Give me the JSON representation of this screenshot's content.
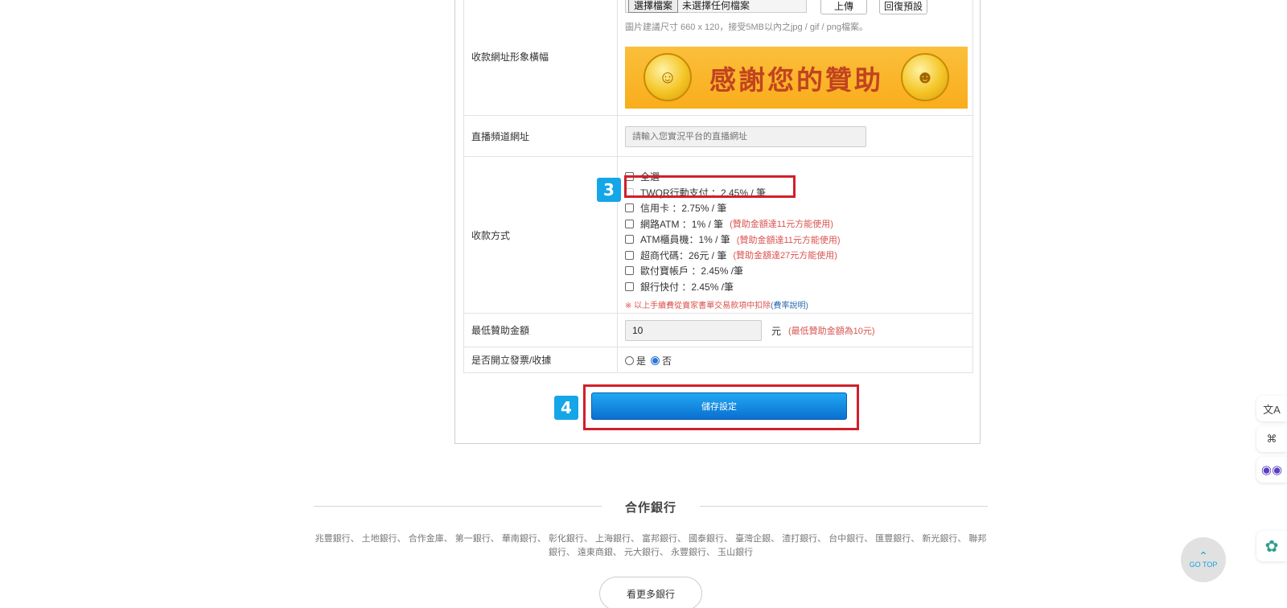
{
  "form": {
    "banner_row": {
      "label": "收款網址形象橫幅",
      "choose_file": "選擇檔案",
      "no_file": "未選擇任何檔案",
      "upload": "上傳",
      "reset": "回復預設",
      "hint": "圖片建議尺寸 660 x 120，接受5MB以內之jpg / gif / png檔案。",
      "banner_text": "感謝您的贊助"
    },
    "live_row": {
      "label": "直播頻道網址",
      "placeholder": "請輸入您實況平台的直播網址"
    },
    "payment_row": {
      "label": "收款方式",
      "select_all": "全選",
      "methods": [
        {
          "label": "TWQR行動支付 ：2.45% / 筆",
          "note": ""
        },
        {
          "label": "信用卡 ：2.75% / 筆",
          "note": ""
        },
        {
          "label": "網路ATM ：1% / 筆",
          "note": "(贊助金額達11元方能使用)"
        },
        {
          "label": "ATM櫃員機：1% / 筆",
          "note": "(贊助金額達11元方能使用)"
        },
        {
          "label": "超商代碼：26元 / 筆",
          "note": "(贊助金額達27元方能使用)"
        },
        {
          "label": "歐付寶帳戶 ：2.45% /筆",
          "note": ""
        },
        {
          "label": "銀行快付 ：2.45% /筆",
          "note": ""
        }
      ],
      "fee_note": "※ 以上手續費從賣家書單交易款項中扣除",
      "fee_link": "(費率說明)"
    },
    "min_row": {
      "label": "最低贊助金額",
      "value": "10",
      "unit": "元",
      "note": "(最低贊助金額為10元)"
    },
    "invoice_row": {
      "label": "是否開立發票/收據",
      "yes": "是",
      "no": "否",
      "selected": "否"
    },
    "save_label": "儲存設定"
  },
  "badges": {
    "step3": "3",
    "step4": "4"
  },
  "partners": {
    "title": "合作銀行",
    "banks": "兆豐銀行、 土地銀行、 合作金庫、 第一銀行、 華南銀行、 彰化銀行、 上海銀行、 富邦銀行、 國泰銀行、 臺灣企銀、 渣打銀行、 台中銀行、 匯豐銀行、 新光銀行、 聯邦銀行、 遠東商銀、 元大銀行、 永豐銀行、 玉山銀行",
    "more": "看更多銀行"
  },
  "gotop": {
    "label": "GO TOP"
  },
  "colors": {
    "accent_blue": "#0b6fd0",
    "highlight_red": "#d0202a",
    "badge_blue": "#14a6e6",
    "note_red": "#d9534f"
  }
}
